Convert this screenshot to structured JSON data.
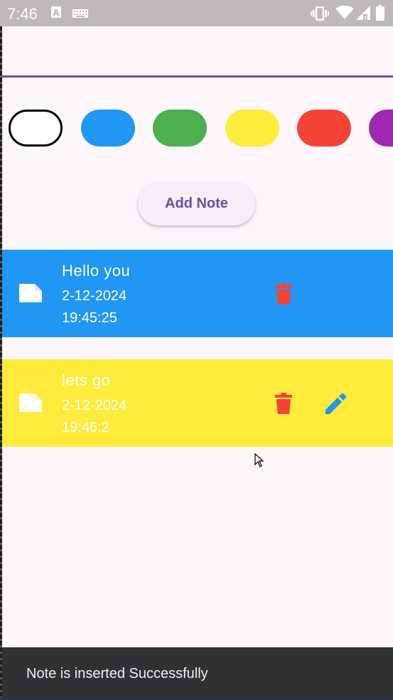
{
  "status_bar": {
    "time": "7:46",
    "icons": [
      "font-a-icon",
      "keyboard-icon",
      "vibrate-icon",
      "wifi-icon",
      "signal-icon",
      "battery-icon"
    ]
  },
  "note_input": {
    "value": ""
  },
  "colors": [
    {
      "name": "white",
      "hex": "#ffffff",
      "selected": true
    },
    {
      "name": "blue",
      "hex": "#2196f3",
      "selected": false
    },
    {
      "name": "green",
      "hex": "#4caf50",
      "selected": false
    },
    {
      "name": "yellow",
      "hex": "#ffeb3b",
      "selected": false
    },
    {
      "name": "red",
      "hex": "#f44336",
      "selected": false
    },
    {
      "name": "purple",
      "hex": "#9c27b0",
      "selected": false
    }
  ],
  "add_button": {
    "label": "Add Note"
  },
  "notes": [
    {
      "title": "Hello you",
      "date": "2-12-2024",
      "time": "19:45:25",
      "bg": "#2196f3",
      "has_edit": false
    },
    {
      "title": "lets go",
      "date": "2-12-2024",
      "time": "19:46:2",
      "bg": "#ffeb3b",
      "has_edit": true
    }
  ],
  "accent": {
    "primary": "#6750a4",
    "delete": "#f44336",
    "edit": "#2196f3"
  },
  "snackbar": {
    "message": "Note is inserted Successfully"
  }
}
